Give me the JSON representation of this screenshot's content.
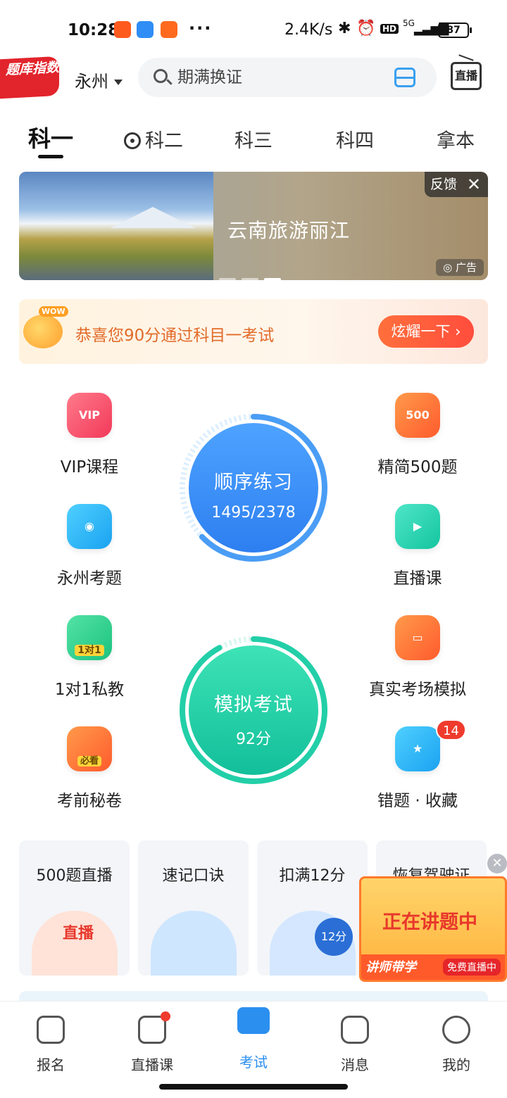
{
  "status_bar": {
    "time": "10:28",
    "net_speed": "2.4K/s",
    "battery": "87",
    "signal_label": "5G",
    "hd_label": "HD",
    "more": "···"
  },
  "header": {
    "logo_text": "题库指数",
    "city": "永州",
    "search_placeholder": "期满换证",
    "live_label": "直播"
  },
  "tabs": [
    {
      "label": "科一",
      "active": true
    },
    {
      "label": "科二",
      "active": false
    },
    {
      "label": "科三",
      "active": false
    },
    {
      "label": "科四",
      "active": false
    },
    {
      "label": "拿本",
      "active": false
    }
  ],
  "banner": {
    "title": "云南旅游丽江",
    "feedback": "反馈",
    "close": "✕",
    "ad_label": "广告",
    "active_dot": 3,
    "dot_count": 3
  },
  "congrats": {
    "badge": "WOW",
    "text": "恭喜您90分通过科目一考试",
    "button": "炫耀一下 ›"
  },
  "features_left": [
    {
      "label": "VIP课程",
      "icon": "vip-icon",
      "icon_text": "VIP"
    },
    {
      "label": "永州考题",
      "icon": "location-icon",
      "icon_text": ""
    },
    {
      "label": "1对1私教",
      "icon": "tutor-icon",
      "icon_text": "1对1"
    },
    {
      "label": "考前秘卷",
      "icon": "secret-paper-icon",
      "icon_text": "必看"
    }
  ],
  "features_right": [
    {
      "label": "精简500题",
      "icon": "500-icon",
      "icon_text": "500"
    },
    {
      "label": "直播课",
      "icon": "video-icon",
      "icon_text": ""
    },
    {
      "label": "真实考场模拟",
      "icon": "monitor-icon",
      "icon_text": ""
    },
    {
      "label": "错题 · 收藏",
      "icon": "star-bookmark-icon",
      "icon_text": "",
      "badge": "14"
    }
  ],
  "practice": {
    "title": "顺序练习",
    "value": "1495/2378",
    "progress": 0.6287
  },
  "exam": {
    "title": "模拟考试",
    "value": "92分",
    "progress": 0.92
  },
  "cards": [
    {
      "title": "500题直播",
      "art_label": "直播"
    },
    {
      "title": "速记口诀",
      "art_label": ""
    },
    {
      "title": "扣满12分",
      "art_label": "12分"
    },
    {
      "title": "恢复驾驶证",
      "art_label": ""
    }
  ],
  "float_live": {
    "text": "正在讲题中",
    "teacher": "讲师带学",
    "free": "免费直播中",
    "close": "✕"
  },
  "bottom_nav": [
    {
      "label": "报名",
      "icon": "signup-icon",
      "active": false
    },
    {
      "label": "直播课",
      "icon": "tv-icon",
      "active": false,
      "dot": true
    },
    {
      "label": "考试",
      "icon": "exam-folder-icon",
      "active": true
    },
    {
      "label": "消息",
      "icon": "message-icon",
      "active": false
    },
    {
      "label": "我的",
      "icon": "profile-icon",
      "active": false
    }
  ],
  "colors": {
    "accent": "#2b8ff0",
    "practice_ring": "#3b8ef2",
    "exam_ring": "#22cfa8",
    "badge_red": "#ef3b2d",
    "congrats_text": "#e26b2a"
  }
}
